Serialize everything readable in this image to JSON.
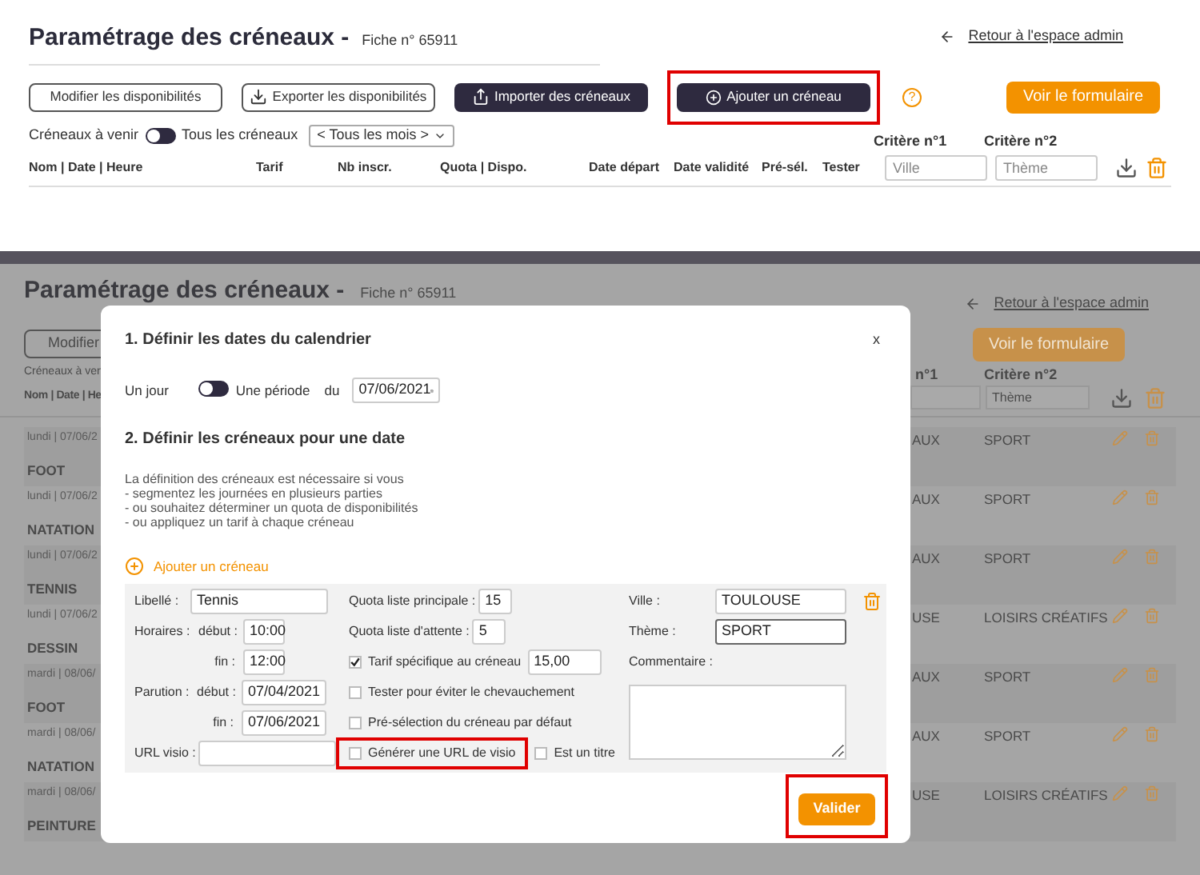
{
  "top": {
    "title": "Paramétrage des créneaux -",
    "fiche": "Fiche n° 65911",
    "back_link": "Retour à l'espace admin",
    "buttons": [
      {
        "label": "Modifier les disponibilités",
        "kind": "outline",
        "highlighted": false
      },
      {
        "label": "Exporter les disponibilités",
        "kind": "export",
        "highlighted": false
      },
      {
        "label": "Importer des créneaux",
        "kind": "import",
        "highlighted": false
      },
      {
        "label": "Ajouter un créneau",
        "kind": "add",
        "highlighted": true
      }
    ],
    "help": "?",
    "form_button": "Voir le formulaire",
    "filter": {
      "label_left": "Créneaux à venir",
      "on": false,
      "label_right": "Tous les créneaux",
      "select": "< Tous les mois >"
    },
    "criteria": [
      {
        "label": "Critère n°1",
        "placeholder": "Ville"
      },
      {
        "label": "Critère n°2",
        "placeholder": "Thème"
      }
    ],
    "columns": [
      "Nom | Date | Heure",
      "Tarif",
      "Nb inscr.",
      "Quota | Dispo.",
      "Date départ",
      "Date validité",
      "Pré-sél.",
      "Tester"
    ]
  },
  "background": {
    "title": "Paramétrage des créneaux -",
    "fiche": "Fiche n° 65911",
    "back_link": "Retour à l'espace admin",
    "button": "Modifier",
    "form_button": "Voir le formulaire",
    "filter_label": "Créneaux à ven",
    "criterion_1": "n°1",
    "criterion_2": "Critère n°2",
    "theme_placeholder": "Thème",
    "column": "Nom | Date | He",
    "rows": [
      {
        "date": "lundi | 07/06/2",
        "name": "FOOT",
        "ville": "AUX",
        "theme": "SPORT"
      },
      {
        "date": "lundi | 07/06/2",
        "name": "NATATION",
        "ville": "AUX",
        "theme": "SPORT"
      },
      {
        "date": "lundi | 07/06/2",
        "name": "TENNIS",
        "ville": "AUX",
        "theme": "SPORT"
      },
      {
        "date": "lundi | 07/06/2",
        "name": "DESSIN",
        "ville": "USE",
        "theme": "LOISIRS CRÉATIFS"
      },
      {
        "date": "mardi | 08/06/",
        "name": "FOOT",
        "ville": "AUX",
        "theme": "SPORT"
      },
      {
        "date": "mardi | 08/06/",
        "name": "NATATION",
        "ville": "AUX",
        "theme": "SPORT"
      },
      {
        "date": "mardi | 08/06/",
        "name": "PEINTURE",
        "ville": "USE",
        "theme": "LOISIRS CRÉATIFS"
      }
    ]
  },
  "modal": {
    "section_1": "1. Définir les dates du calendrier",
    "close": "x",
    "day_label": "Un jour",
    "period_on": false,
    "period_label": "Une période",
    "from_label": "du",
    "from_date": "07/06/2021",
    "section_2": "2. Définir les créneaux pour une date",
    "intro": [
      "La définition des créneaux est nécessaire si vous",
      "- segmentez les journées en plusieurs parties",
      "- ou souhaitez déterminer un quota de disponibilités",
      "- ou appliquez un tarif à chaque créneau"
    ],
    "add_link": "Ajouter un créneau",
    "slot": {
      "libelle_label": "Libellé :",
      "libelle": "Tennis",
      "horaires_label": "Horaires :",
      "start_label": "début :",
      "start": "10:00",
      "end_label": "fin :",
      "end": "12:00",
      "parution_label": "Parution :",
      "pub_start_label": "début :",
      "pub_start": "07/04/2021",
      "pub_end_label": "fin :",
      "pub_end": "07/06/2021",
      "url_label": "URL visio :",
      "quota_main_label": "Quota liste principale :",
      "quota_main": "15",
      "quota_wait_label": "Quota liste d'attente :",
      "quota_wait": "5",
      "options": [
        {
          "label": "Tarif spécifique au créneau",
          "checked": true,
          "value": "15,00",
          "highlighted": false
        },
        {
          "label": "Tester pour éviter le chevauchement",
          "checked": false,
          "highlighted": false
        },
        {
          "label": "Pré-sélection du créneau par défaut",
          "checked": false,
          "highlighted": false
        }
      ],
      "visio": {
        "label": "Générer une URL de visio",
        "checked": false,
        "highlighted": true
      },
      "title_opt": {
        "label": "Est un titre",
        "checked": false
      },
      "ville_label": "Ville :",
      "ville": "TOULOUSE",
      "theme_label": "Thème :",
      "theme": "SPORT",
      "comment_label": "Commentaire :"
    },
    "submit": {
      "label": "Valider",
      "highlighted": true
    }
  }
}
